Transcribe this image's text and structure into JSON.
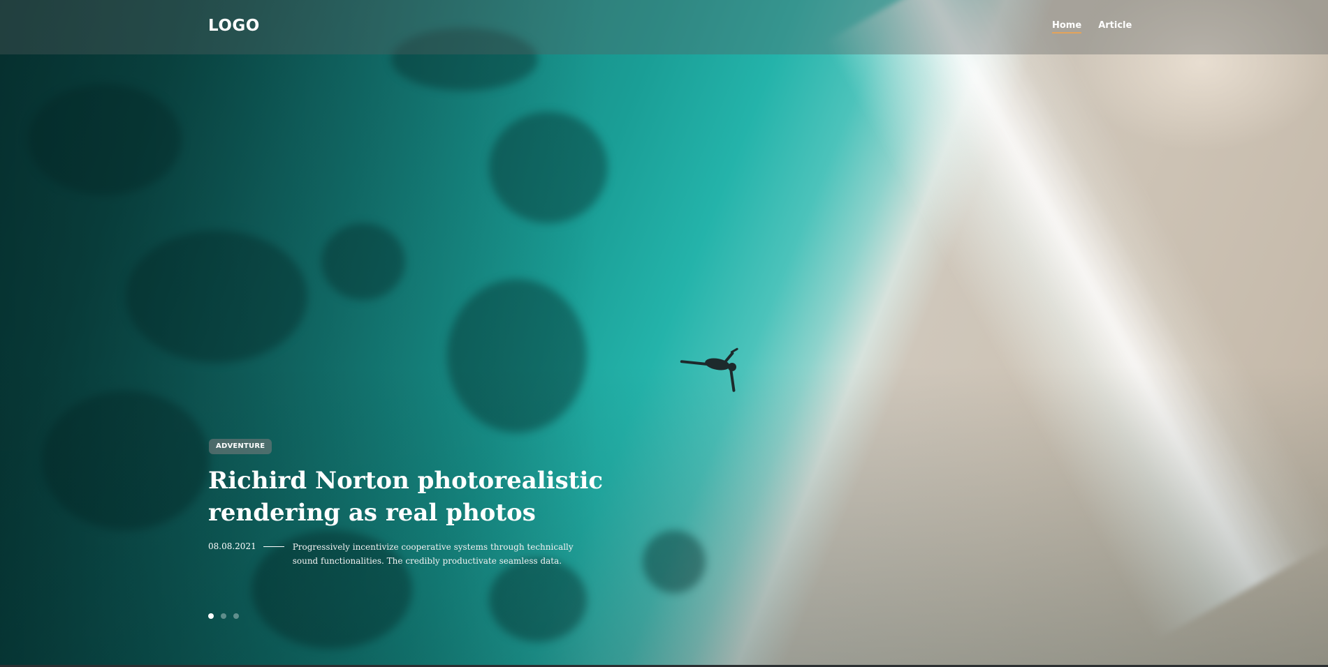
{
  "header": {
    "logo_text": "LOGO",
    "nav": [
      {
        "label": "Home",
        "active": true
      },
      {
        "label": "Article",
        "active": false
      }
    ],
    "accent_color": "#e3a35a"
  },
  "hero": {
    "badge": "ADVENTURE",
    "title_line1": "Richird Norton photorealistic",
    "title_line2": "rendering as real photos",
    "date": "08.08.2021",
    "description": "Progressively incentivize cooperative systems through technically sound functionalities. The credibly productivate seamless data.",
    "slider": {
      "total": 3,
      "active_index": 0
    },
    "background": "aerial-beach-swimmer-photo"
  }
}
